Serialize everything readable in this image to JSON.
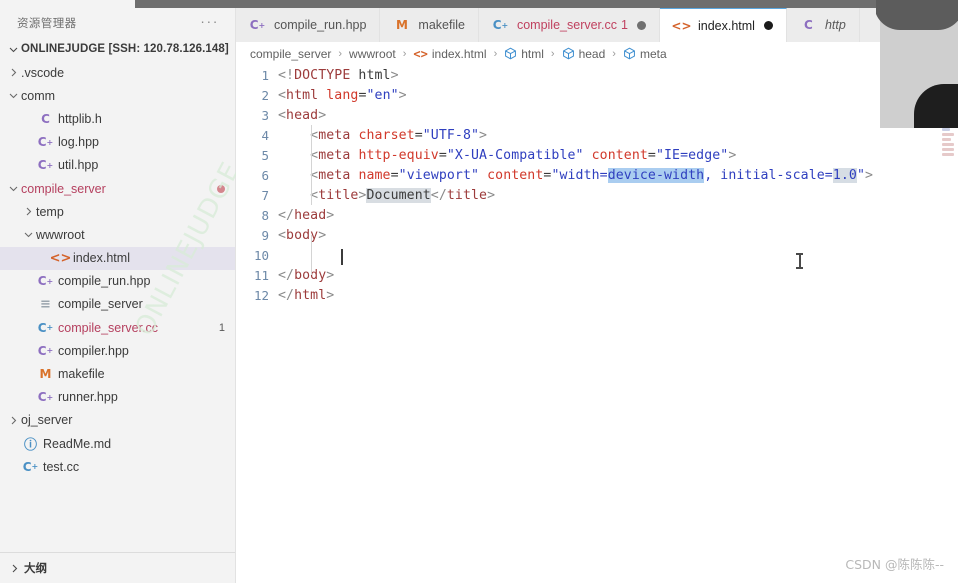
{
  "sidebar": {
    "title": "资源管理器",
    "more_label": "···",
    "root": {
      "label": "ONLINEJUDGE [SSH: 120.78.126.148]",
      "expanded": true
    },
    "items": [
      {
        "label": ".vscode",
        "icon": "",
        "indent": 1,
        "type": "folder",
        "expanded": false
      },
      {
        "label": "comm",
        "icon": "",
        "indent": 1,
        "type": "folder",
        "expanded": true
      },
      {
        "label": "httplib.h",
        "icon": "c-header",
        "indent": 2,
        "type": "file"
      },
      {
        "label": "log.hpp",
        "icon": "cpp-header",
        "indent": 2,
        "type": "file"
      },
      {
        "label": "util.hpp",
        "icon": "cpp-header",
        "indent": 2,
        "type": "file"
      },
      {
        "label": "compile_server",
        "icon": "",
        "indent": 1,
        "type": "folder",
        "expanded": true,
        "modified": true,
        "dot": true
      },
      {
        "label": "temp",
        "icon": "",
        "indent": 2,
        "type": "folder",
        "expanded": false
      },
      {
        "label": "wwwroot",
        "icon": "",
        "indent": 2,
        "type": "folder",
        "expanded": true
      },
      {
        "label": "index.html",
        "icon": "html",
        "indent": 3,
        "type": "file",
        "selected": true
      },
      {
        "label": "compile_run.hpp",
        "icon": "cpp-header",
        "indent": 2,
        "type": "file"
      },
      {
        "label": "compile_server",
        "icon": "binary",
        "indent": 2,
        "type": "file"
      },
      {
        "label": "compile_server.cc",
        "icon": "cpp-source",
        "indent": 2,
        "type": "file",
        "modified": true,
        "badge": "1"
      },
      {
        "label": "compiler.hpp",
        "icon": "cpp-header",
        "indent": 2,
        "type": "file"
      },
      {
        "label": "makefile",
        "icon": "makefile",
        "indent": 2,
        "type": "file"
      },
      {
        "label": "runner.hpp",
        "icon": "cpp-header",
        "indent": 2,
        "type": "file"
      },
      {
        "label": "oj_server",
        "icon": "",
        "indent": 1,
        "type": "folder",
        "expanded": false
      },
      {
        "label": "ReadMe.md",
        "icon": "markdown",
        "indent": 1,
        "type": "file"
      },
      {
        "label": "test.cc",
        "icon": "cpp-source",
        "indent": 1,
        "type": "file"
      }
    ],
    "bottom_panel": {
      "label": "大纲",
      "expanded": false
    }
  },
  "tabs": [
    {
      "label": "compile_run.hpp",
      "icon": "cpp-header",
      "active": false,
      "modified": false,
      "count": "",
      "dot": false
    },
    {
      "label": "makefile",
      "icon": "makefile",
      "active": false,
      "modified": false,
      "count": "",
      "dot": false
    },
    {
      "label": "compile_server.cc",
      "icon": "cpp-source",
      "active": false,
      "modified": true,
      "count": "1",
      "dot": true
    },
    {
      "label": "index.html",
      "icon": "html",
      "active": true,
      "modified": false,
      "count": "",
      "dot": true
    },
    {
      "label": "http",
      "icon": "c-header",
      "active": false,
      "modified": false,
      "count": "",
      "dot": false,
      "italic": true
    }
  ],
  "breadcrumb": [
    {
      "label": "compile_server",
      "icon": ""
    },
    {
      "label": "wwwroot",
      "icon": ""
    },
    {
      "label": "index.html",
      "icon": "html"
    },
    {
      "label": "html",
      "icon": "symbol-cube"
    },
    {
      "label": "head",
      "icon": "symbol-cube"
    },
    {
      "label": "meta",
      "icon": "symbol-cube"
    }
  ],
  "breadcrumb_separator": "›",
  "editor": {
    "language": "html",
    "line_numbers": [
      "1",
      "2",
      "3",
      "4",
      "5",
      "6",
      "7",
      "8",
      "9",
      "10",
      "11",
      "12"
    ],
    "lines": [
      {
        "n": "1",
        "text": "<!DOCTYPE html>"
      },
      {
        "n": "2",
        "text": "<html lang=\"en\">"
      },
      {
        "n": "3",
        "text": "<head>"
      },
      {
        "n": "4",
        "text": "    <meta charset=\"UTF-8\">"
      },
      {
        "n": "5",
        "text": "    <meta http-equiv=\"X-UA-Compatible\" content=\"IE=edge\">"
      },
      {
        "n": "6",
        "text": "    <meta name=\"viewport\" content=\"width=device-width, initial-scale=1.0\">"
      },
      {
        "n": "7",
        "text": "    <title>Document</title>"
      },
      {
        "n": "8",
        "text": "</head>"
      },
      {
        "n": "9",
        "text": "<body>"
      },
      {
        "n": "10",
        "text": "    "
      },
      {
        "n": "11",
        "text": "</body>"
      },
      {
        "n": "12",
        "text": "</html>"
      }
    ],
    "selection": {
      "text": "device-width",
      "line": 6
    },
    "soft_highlights": [
      "1.0",
      "Document"
    ],
    "caret_line": 10
  },
  "colors": {
    "accent_blue": "#5aa7e0",
    "selection_blue": "#aacdf0",
    "modified_red": "#c0415f",
    "tag_red": "#9c3b3b",
    "attr_red": "#d1392b",
    "string_blue": "#2f3fbf",
    "line_number": "#6d89a8",
    "sidebar_bg": "#f3f3f3",
    "tabbar_bg": "#ececec",
    "selected_row": "#e4e2ed"
  },
  "watermark": {
    "text": "CSDN @陈陈陈--",
    "tree_text": "ONLINEJUDGE"
  }
}
